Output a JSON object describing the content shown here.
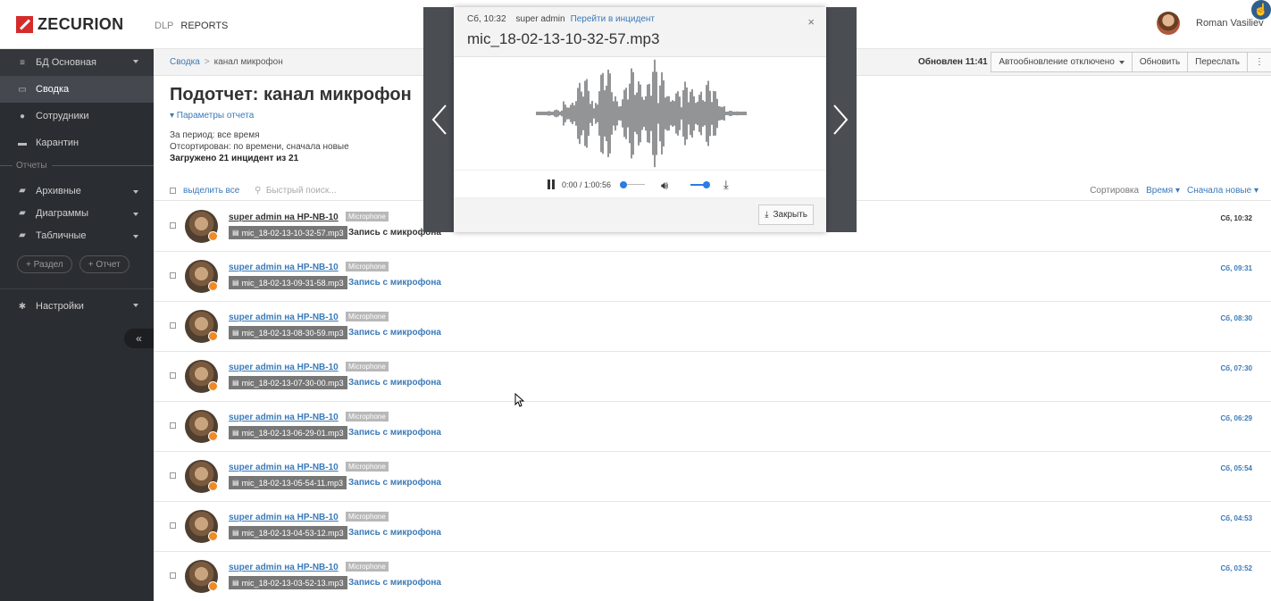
{
  "header": {
    "logo_text": "ZECURION",
    "nav": [
      "DLP",
      "REPORTS"
    ],
    "user_name": "Roman Vasiliev",
    "corner_icon": "hand-pointer-icon"
  },
  "sidebar": {
    "db_label": "БД Основная",
    "items": [
      {
        "label": "Сводка",
        "icon": "laptop-icon"
      },
      {
        "label": "Сотрудники",
        "icon": "user-icon"
      },
      {
        "label": "Карантин",
        "icon": "monitor-icon"
      }
    ],
    "reports_section": "Отчеты",
    "report_folders": [
      {
        "label": "Архивные"
      },
      {
        "label": "Диаграммы"
      },
      {
        "label": "Табличные"
      }
    ],
    "add_section_label": "Раздел",
    "add_report_label": "Отчет",
    "settings_label": "Настройки",
    "collapse_label": "«"
  },
  "toolbar": {
    "breadcrumb_root": "Сводка",
    "breadcrumb_sep": ">",
    "breadcrumb_current": "канал микрофон",
    "updated": "Обновлен 11:41",
    "autoupdate": "Автообновление отключено",
    "refresh": "Обновить",
    "forward": "Переслать",
    "more": "⋮"
  },
  "report": {
    "title": "Подотчет: канал микрофон",
    "params": "▾ Параметры отчета",
    "period": "За период: все время",
    "sorted": "Отсортирован: по времени, сначала новые",
    "loaded_prefix": "Загружено ",
    "loaded_count": "21",
    "loaded_mid": " инцидент из ",
    "loaded_total": "21"
  },
  "list": {
    "select_all": "выделить все",
    "search_placeholder": "Быстрый поиск...",
    "sort_label": "Сортировка",
    "sort_field": "Время",
    "sort_order": "Сначала новые",
    "rows": [
      {
        "who": "super admin на HP-NB-10",
        "tag": "Microphone",
        "file": "mic_18-02-13-10-32-57.mp3",
        "rec": "Запись с микрофона",
        "time": "Сб, 10:32"
      },
      {
        "who": "super admin на HP-NB-10",
        "tag": "Microphone",
        "file": "mic_18-02-13-09-31-58.mp3",
        "rec": "Запись с микрофона",
        "time": "Сб, 09:31"
      },
      {
        "who": "super admin на HP-NB-10",
        "tag": "Microphone",
        "file": "mic_18-02-13-08-30-59.mp3",
        "rec": "Запись с микрофона",
        "time": "Сб, 08:30"
      },
      {
        "who": "super admin на HP-NB-10",
        "tag": "Microphone",
        "file": "mic_18-02-13-07-30-00.mp3",
        "rec": "Запись с микрофона",
        "time": "Сб, 07:30"
      },
      {
        "who": "super admin на HP-NB-10",
        "tag": "Microphone",
        "file": "mic_18-02-13-06-29-01.mp3",
        "rec": "Запись с микрофона",
        "time": "Сб, 06:29"
      },
      {
        "who": "super admin на HP-NB-10",
        "tag": "Microphone",
        "file": "mic_18-02-13-05-54-11.mp3",
        "rec": "Запись с микрофона",
        "time": "Сб, 05:54"
      },
      {
        "who": "super admin на HP-NB-10",
        "tag": "Microphone",
        "file": "mic_18-02-13-04-53-12.mp3",
        "rec": "Запись с микрофона",
        "time": "Сб, 04:53"
      },
      {
        "who": "super admin на HP-NB-10",
        "tag": "Microphone",
        "file": "mic_18-02-13-03-52-13.mp3",
        "rec": "Запись с микрофона",
        "time": "Сб, 03:52"
      }
    ]
  },
  "modal": {
    "time": "Сб, 10:32",
    "user": "super admin",
    "goto_link": "Перейти в инцидент",
    "title": "mic_18-02-13-10-32-57.mp3",
    "close_x": "×",
    "player_time": "0:00 / 1:00:56",
    "seek_position": 0,
    "volume_level": 0.9,
    "close_label": "Закрыть"
  },
  "colors": {
    "accent": "#3a7ab8",
    "sidebar_bg": "#2a2d31",
    "player_blue": "#2a7de1",
    "logo_red": "#d42b2b",
    "status_orange": "#f08a24"
  }
}
